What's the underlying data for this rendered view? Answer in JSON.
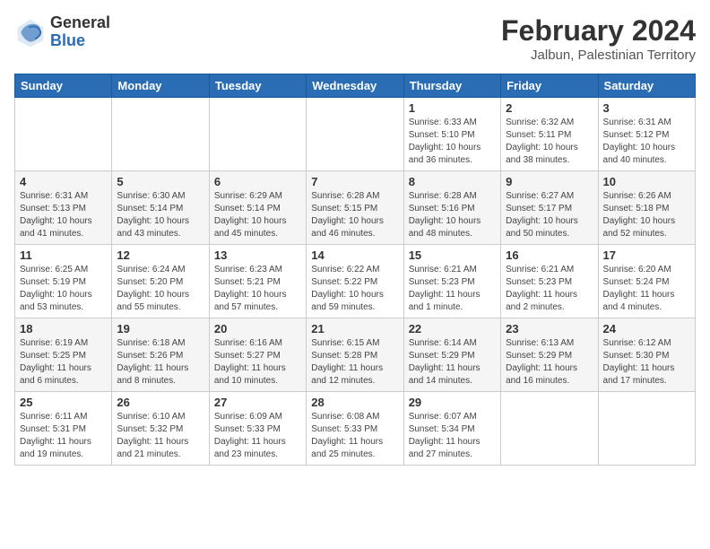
{
  "logo": {
    "general": "General",
    "blue": "Blue"
  },
  "title": {
    "month_year": "February 2024",
    "location": "Jalbun, Palestinian Territory"
  },
  "weekdays": [
    "Sunday",
    "Monday",
    "Tuesday",
    "Wednesday",
    "Thursday",
    "Friday",
    "Saturday"
  ],
  "weeks": [
    [
      {
        "day": "",
        "info": ""
      },
      {
        "day": "",
        "info": ""
      },
      {
        "day": "",
        "info": ""
      },
      {
        "day": "",
        "info": ""
      },
      {
        "day": "1",
        "info": "Sunrise: 6:33 AM\nSunset: 5:10 PM\nDaylight: 10 hours\nand 36 minutes."
      },
      {
        "day": "2",
        "info": "Sunrise: 6:32 AM\nSunset: 5:11 PM\nDaylight: 10 hours\nand 38 minutes."
      },
      {
        "day": "3",
        "info": "Sunrise: 6:31 AM\nSunset: 5:12 PM\nDaylight: 10 hours\nand 40 minutes."
      }
    ],
    [
      {
        "day": "4",
        "info": "Sunrise: 6:31 AM\nSunset: 5:13 PM\nDaylight: 10 hours\nand 41 minutes."
      },
      {
        "day": "5",
        "info": "Sunrise: 6:30 AM\nSunset: 5:14 PM\nDaylight: 10 hours\nand 43 minutes."
      },
      {
        "day": "6",
        "info": "Sunrise: 6:29 AM\nSunset: 5:14 PM\nDaylight: 10 hours\nand 45 minutes."
      },
      {
        "day": "7",
        "info": "Sunrise: 6:28 AM\nSunset: 5:15 PM\nDaylight: 10 hours\nand 46 minutes."
      },
      {
        "day": "8",
        "info": "Sunrise: 6:28 AM\nSunset: 5:16 PM\nDaylight: 10 hours\nand 48 minutes."
      },
      {
        "day": "9",
        "info": "Sunrise: 6:27 AM\nSunset: 5:17 PM\nDaylight: 10 hours\nand 50 minutes."
      },
      {
        "day": "10",
        "info": "Sunrise: 6:26 AM\nSunset: 5:18 PM\nDaylight: 10 hours\nand 52 minutes."
      }
    ],
    [
      {
        "day": "11",
        "info": "Sunrise: 6:25 AM\nSunset: 5:19 PM\nDaylight: 10 hours\nand 53 minutes."
      },
      {
        "day": "12",
        "info": "Sunrise: 6:24 AM\nSunset: 5:20 PM\nDaylight: 10 hours\nand 55 minutes."
      },
      {
        "day": "13",
        "info": "Sunrise: 6:23 AM\nSunset: 5:21 PM\nDaylight: 10 hours\nand 57 minutes."
      },
      {
        "day": "14",
        "info": "Sunrise: 6:22 AM\nSunset: 5:22 PM\nDaylight: 10 hours\nand 59 minutes."
      },
      {
        "day": "15",
        "info": "Sunrise: 6:21 AM\nSunset: 5:23 PM\nDaylight: 11 hours\nand 1 minute."
      },
      {
        "day": "16",
        "info": "Sunrise: 6:21 AM\nSunset: 5:23 PM\nDaylight: 11 hours\nand 2 minutes."
      },
      {
        "day": "17",
        "info": "Sunrise: 6:20 AM\nSunset: 5:24 PM\nDaylight: 11 hours\nand 4 minutes."
      }
    ],
    [
      {
        "day": "18",
        "info": "Sunrise: 6:19 AM\nSunset: 5:25 PM\nDaylight: 11 hours\nand 6 minutes."
      },
      {
        "day": "19",
        "info": "Sunrise: 6:18 AM\nSunset: 5:26 PM\nDaylight: 11 hours\nand 8 minutes."
      },
      {
        "day": "20",
        "info": "Sunrise: 6:16 AM\nSunset: 5:27 PM\nDaylight: 11 hours\nand 10 minutes."
      },
      {
        "day": "21",
        "info": "Sunrise: 6:15 AM\nSunset: 5:28 PM\nDaylight: 11 hours\nand 12 minutes."
      },
      {
        "day": "22",
        "info": "Sunrise: 6:14 AM\nSunset: 5:29 PM\nDaylight: 11 hours\nand 14 minutes."
      },
      {
        "day": "23",
        "info": "Sunrise: 6:13 AM\nSunset: 5:29 PM\nDaylight: 11 hours\nand 16 minutes."
      },
      {
        "day": "24",
        "info": "Sunrise: 6:12 AM\nSunset: 5:30 PM\nDaylight: 11 hours\nand 17 minutes."
      }
    ],
    [
      {
        "day": "25",
        "info": "Sunrise: 6:11 AM\nSunset: 5:31 PM\nDaylight: 11 hours\nand 19 minutes."
      },
      {
        "day": "26",
        "info": "Sunrise: 6:10 AM\nSunset: 5:32 PM\nDaylight: 11 hours\nand 21 minutes."
      },
      {
        "day": "27",
        "info": "Sunrise: 6:09 AM\nSunset: 5:33 PM\nDaylight: 11 hours\nand 23 minutes."
      },
      {
        "day": "28",
        "info": "Sunrise: 6:08 AM\nSunset: 5:33 PM\nDaylight: 11 hours\nand 25 minutes."
      },
      {
        "day": "29",
        "info": "Sunrise: 6:07 AM\nSunset: 5:34 PM\nDaylight: 11 hours\nand 27 minutes."
      },
      {
        "day": "",
        "info": ""
      },
      {
        "day": "",
        "info": ""
      }
    ]
  ]
}
